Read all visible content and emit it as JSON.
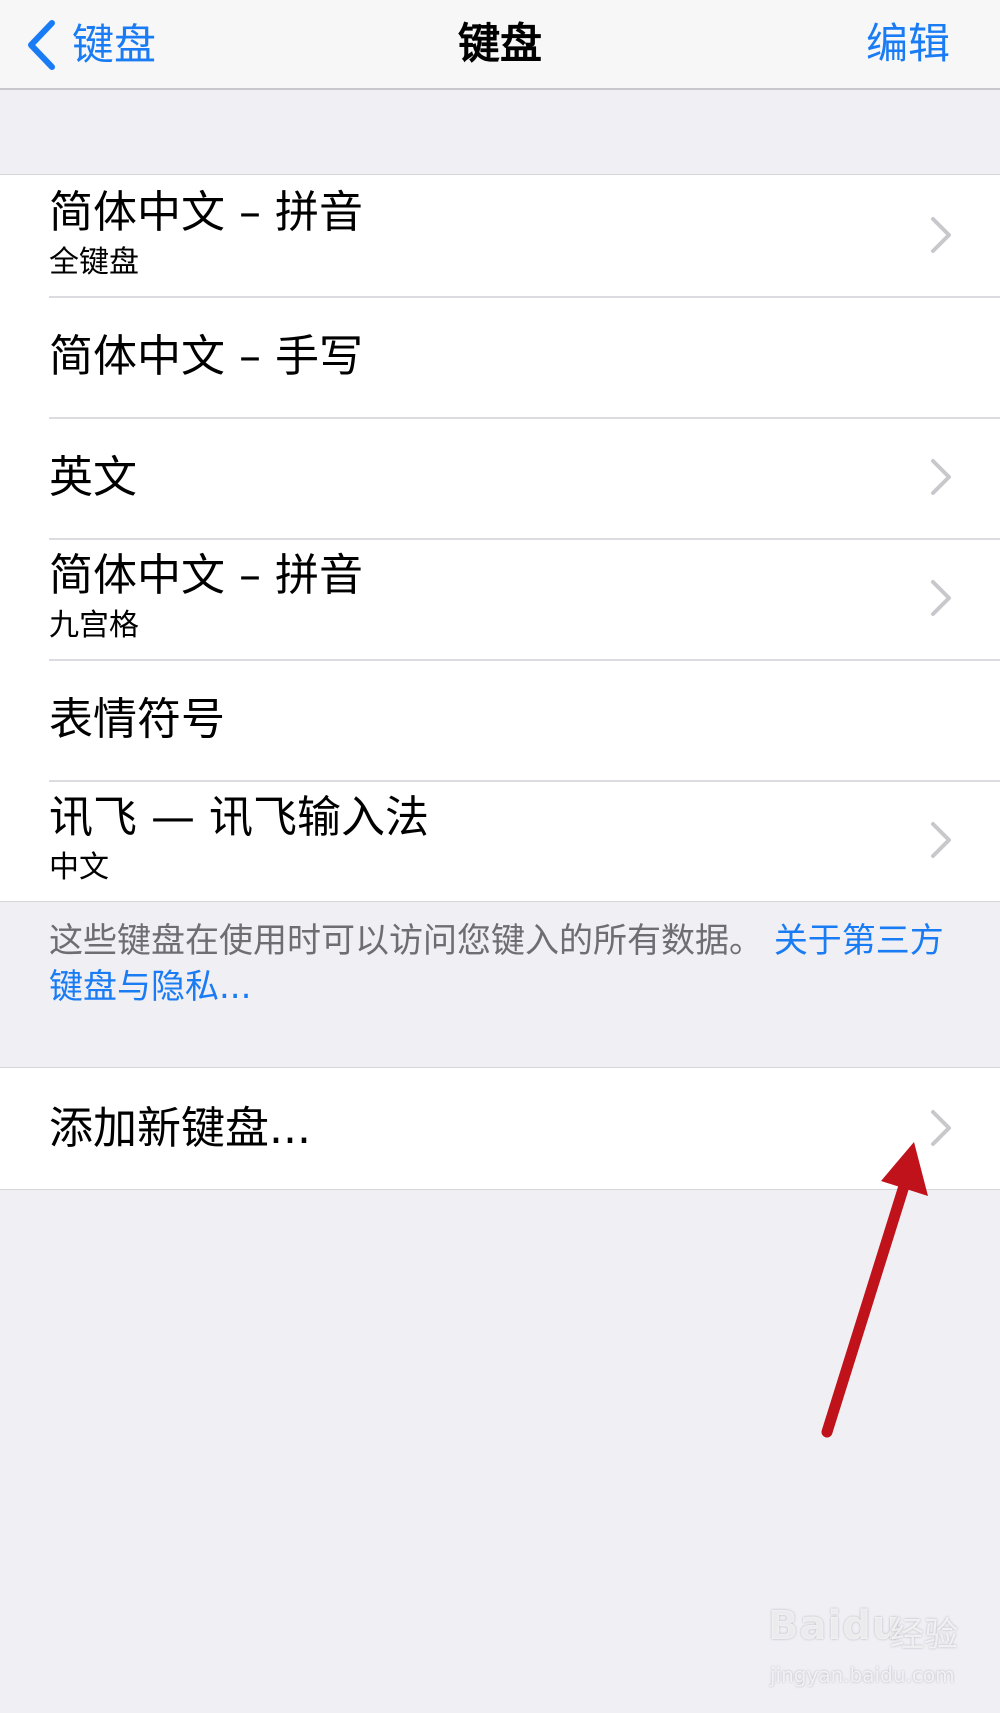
{
  "nav": {
    "back_label": "键盘",
    "title": "键盘",
    "edit_label": "编辑"
  },
  "keyboards": [
    {
      "title": "简体中文 – 拼音",
      "subtitle": "全键盘",
      "has_chevron": true
    },
    {
      "title": "简体中文 – 手写",
      "subtitle": "",
      "has_chevron": false
    },
    {
      "title": "英文",
      "subtitle": "",
      "has_chevron": true
    },
    {
      "title": "简体中文 – 拼音",
      "subtitle": "九宫格",
      "has_chevron": true
    },
    {
      "title": "表情符号",
      "subtitle": "",
      "has_chevron": false
    },
    {
      "title": "讯飞 — 讯飞输入法",
      "subtitle": "中文",
      "has_chevron": true
    }
  ],
  "footer": {
    "note": "这些键盘在使用时可以访问您键入的所有数据。",
    "link": "关于第三方键盘与隐私..."
  },
  "add_keyboard": {
    "label": "添加新键盘..."
  },
  "watermark": {
    "brand": "Baidu",
    "brand_cn": "经验",
    "url": "jingyan.baidu.com"
  },
  "colors": {
    "accent": "#1a7cf5",
    "background": "#efeff4",
    "annotation_arrow": "#c0121b"
  },
  "icons": {
    "back": "chevron-left-icon",
    "row": "chevron-right-icon",
    "annotation": "red-arrow-icon"
  }
}
